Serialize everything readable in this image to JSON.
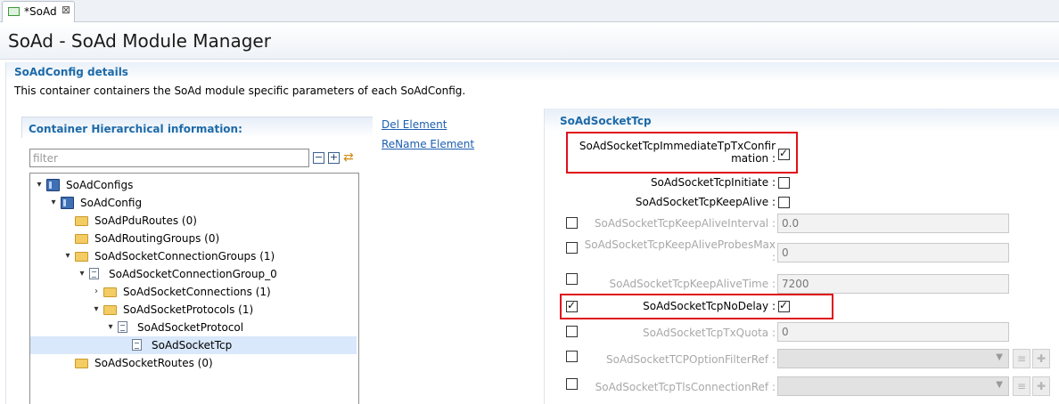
{
  "tab": {
    "label": "*SoAd",
    "close": "⊠"
  },
  "header": {
    "title": "SoAd - SoAd Module Manager"
  },
  "details": {
    "title": "SoAdConfig details",
    "description": "This container containers the SoAd module specific parameters of each SoAdConfig."
  },
  "left_panel": {
    "title": "Container Hierarchical information:",
    "filter_placeholder": "filter",
    "tree": [
      {
        "label": "SoAdConfigs",
        "icon": "config",
        "arrow": "expanded"
      },
      {
        "label": "SoAdConfig",
        "icon": "config",
        "arrow": "expanded"
      },
      {
        "label": "SoAdPduRoutes (0)",
        "icon": "folder",
        "arrow": "none"
      },
      {
        "label": "SoAdRoutingGroups (0)",
        "icon": "folder",
        "arrow": "none"
      },
      {
        "label": "SoAdSocketConnectionGroups (1)",
        "icon": "folder",
        "arrow": "expanded"
      },
      {
        "label": "SoAdSocketConnectionGroup_0",
        "icon": "document",
        "arrow": "expanded"
      },
      {
        "label": "SoAdSocketConnections (1)",
        "icon": "folder",
        "arrow": "collapsed"
      },
      {
        "label": "SoAdSocketProtocols (1)",
        "icon": "folder",
        "arrow": "expanded"
      },
      {
        "label": "SoAdSocketProtocol",
        "icon": "document",
        "arrow": "expanded"
      },
      {
        "label": "SoAdSocketTcp",
        "icon": "document",
        "arrow": "none",
        "selected": true
      },
      {
        "label": "SoAdSocketRoutes (0)",
        "icon": "folder",
        "arrow": "none"
      }
    ]
  },
  "links": {
    "del": "Del Element",
    "rename": "ReName Element"
  },
  "right_panel": {
    "title": "SoAdSocketTcp",
    "params": {
      "immediate_line1": "SoAdSocketTcpImmediateTpTxConfir",
      "immediate_line2": "mation :",
      "immediate_checked": true,
      "initiate": "SoAdSocketTcpInitiate :",
      "initiate_checked": false,
      "keepalive": "SoAdSocketTcpKeepAlive :",
      "keepalive_checked": false,
      "ka_interval": "SoAdSocketTcpKeepAliveInterval :",
      "ka_interval_value": "0.0",
      "ka_probes_line1": "SoAdSocketTcpKeepAliveProbesMax",
      "ka_probes_line2": ":",
      "ka_probes_value": "0",
      "ka_time": "SoAdSocketTcpKeepAliveTime :",
      "ka_time_value": "7200",
      "nodelay": "SoAdSocketTcpNoDelay :",
      "nodelay_enabled": true,
      "nodelay_checked": true,
      "txquota": "SoAdSocketTcpTxQuota :",
      "txquota_value": "0",
      "optfilter": "SoAdSocketTCPOptionFilterRef :",
      "tlsconn": "SoAdSocketTcpTlsConnectionRef :"
    }
  },
  "highlight_color": "#e0101a"
}
